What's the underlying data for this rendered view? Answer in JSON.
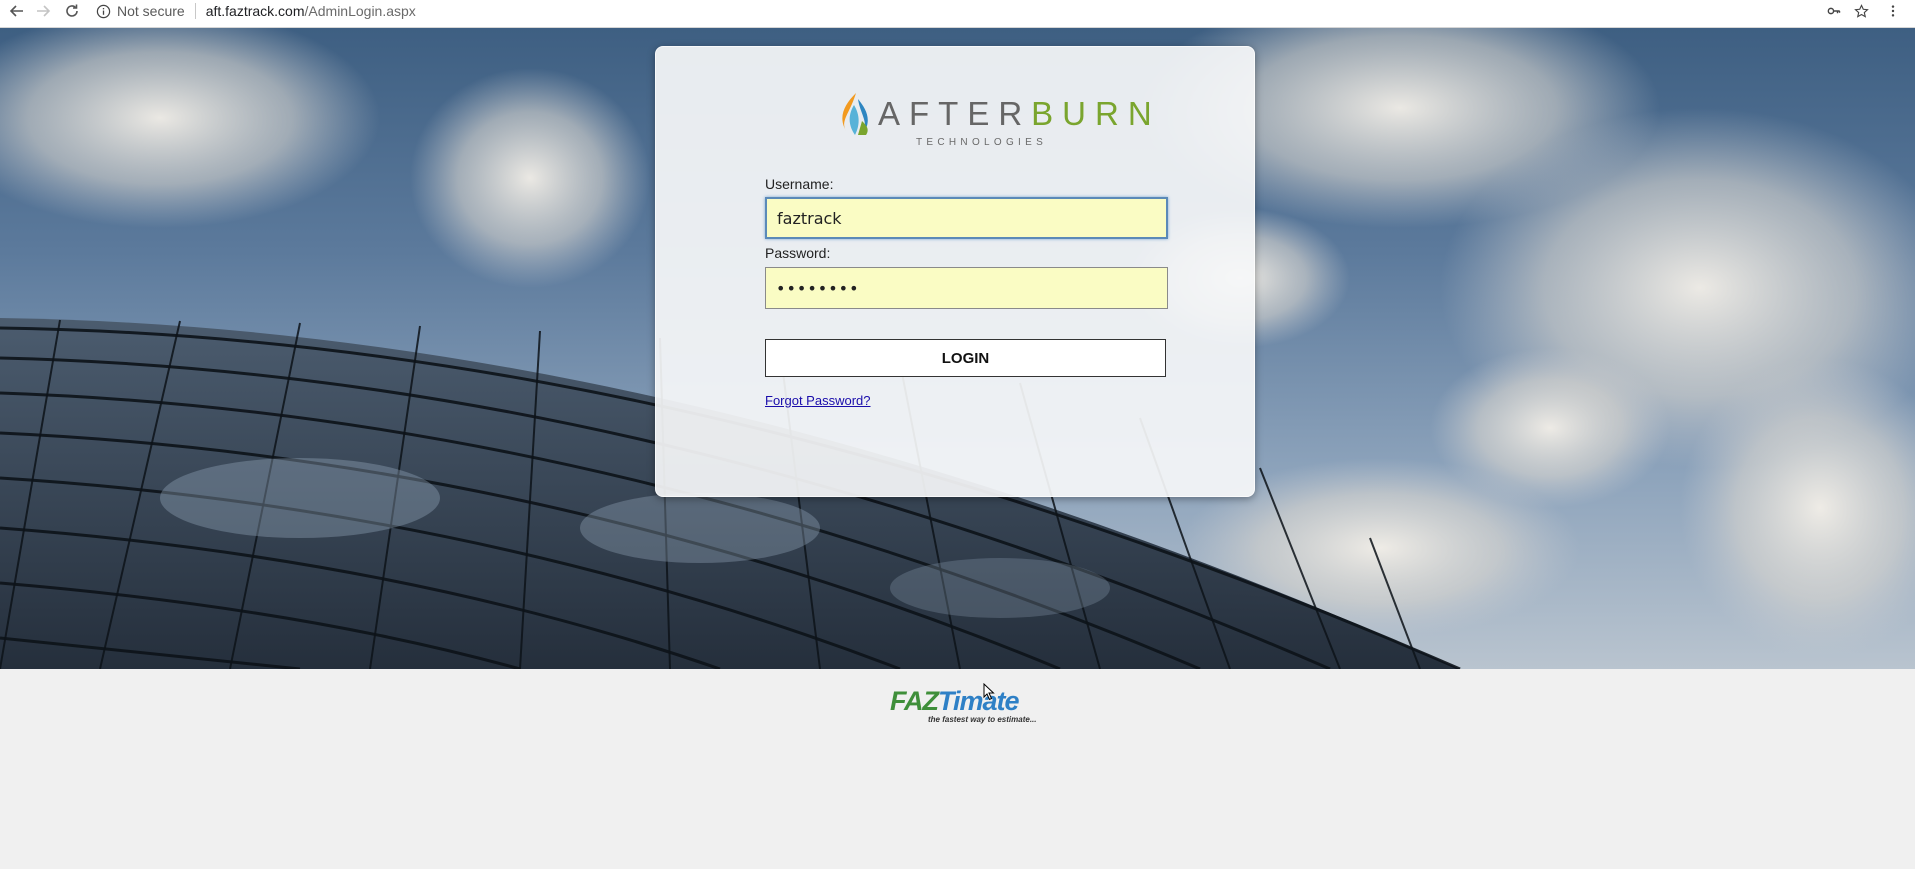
{
  "browser": {
    "security_label": "Not secure",
    "url_host": "aft.faztrack.com",
    "url_path": "/AdminLogin.aspx",
    "icons": [
      "back-arrow-icon",
      "forward-arrow-icon",
      "reload-icon",
      "info-icon",
      "key-icon",
      "star-icon",
      "kebab-menu-icon"
    ]
  },
  "brand": {
    "word_part1": "AFTER",
    "word_part2": "BURN",
    "subtitle": "TECHNOLOGIES",
    "colors": {
      "grey": "#666666",
      "green": "#7aa52e",
      "flame_orange": "#f29a1f",
      "flame_blue": "#2e86c1"
    }
  },
  "login": {
    "username_label": "Username:",
    "username_value": "faztrack",
    "password_label": "Password:",
    "password_value": "••••••••",
    "login_button": "LOGIN",
    "forgot_link": "Forgot Password?"
  },
  "footer": {
    "logo_faz": "FAZ",
    "logo_timate": "Timate",
    "tagline": "the fastest way to estimate..."
  },
  "colors": {
    "field_bg": "#fafcc4",
    "link": "#1a0dab",
    "page_bg": "#f0f0f0"
  }
}
